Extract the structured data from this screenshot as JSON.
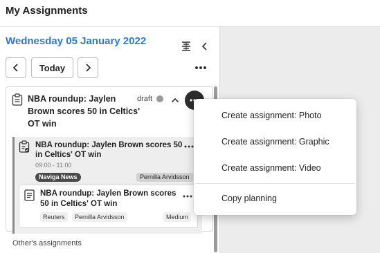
{
  "header": {
    "title": "My Assignments"
  },
  "date_label": "Wednesday 05 January 2022",
  "toolbar": {
    "today_label": "Today"
  },
  "planning": {
    "title": "NBA roundup: Jaylen Brown scores 50 in Celtics' OT win",
    "status": "draft",
    "coverage": {
      "title": "NBA roundup: Jaylen Brown scores 50 in Celtics' OT win",
      "time": "09:00 - 11:00",
      "desk": "Naviga News",
      "user": "Pernilla Arvidsson",
      "article": {
        "title": "NBA roundup: Jaylen Brown scores 50 in Celtics' OT win",
        "source": "Reuters",
        "author": "Pernilla Arvidsson",
        "priority": "Medium"
      }
    }
  },
  "others_label": "Other's assignments",
  "menu": {
    "items": [
      {
        "label": "Create assignment: Photo"
      },
      {
        "label": "Create assignment: Graphic"
      },
      {
        "label": "Create assignment: Video"
      },
      {
        "label": "Copy planning"
      }
    ]
  },
  "icons": {
    "planning": "clipboard-icon",
    "coverage": "clipboard-check-icon",
    "article": "document-icon",
    "filter": "align-center-icon",
    "collapse": "chevron-left-icon",
    "prev": "chevron-left-icon",
    "next": "chevron-right-icon",
    "expand": "chevron-up-icon",
    "more": "more-horizontal-icon"
  },
  "colors": {
    "accent": "#2b7ad6",
    "draft_dot": "#9a9a9a",
    "active_button": "#2c2c2c"
  }
}
